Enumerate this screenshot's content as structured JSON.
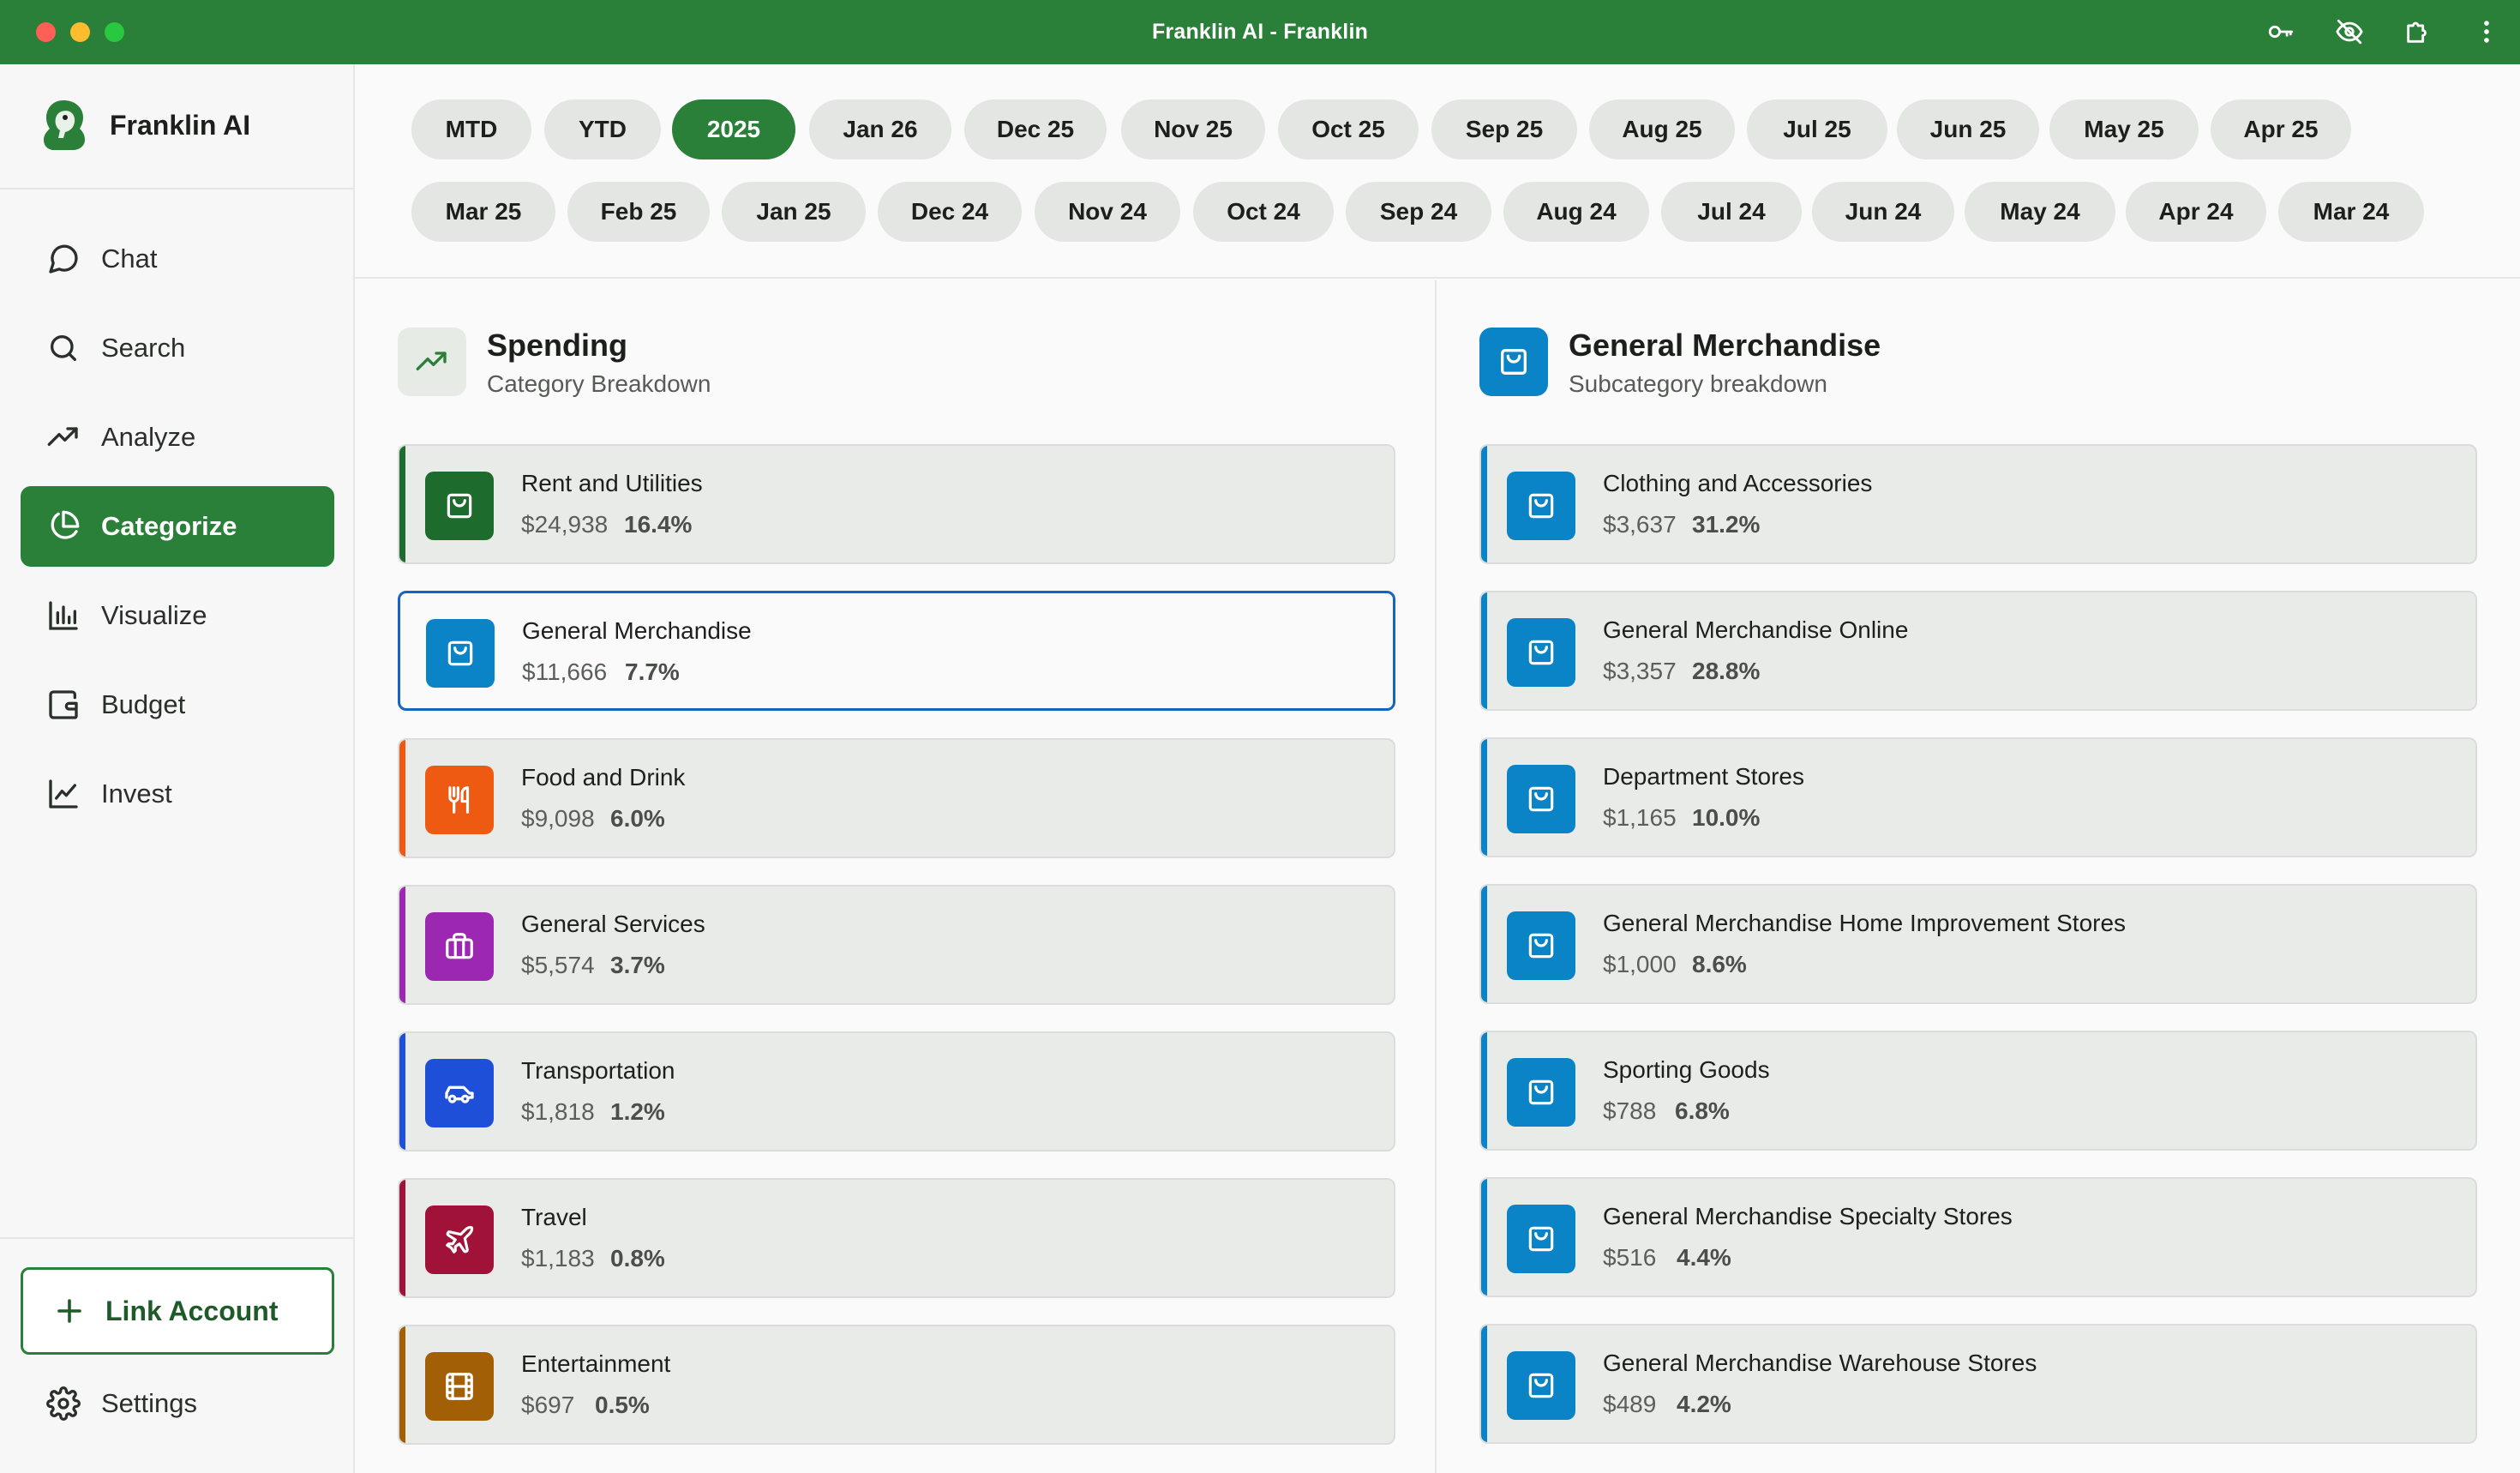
{
  "window": {
    "title": "Franklin AI - Franklin"
  },
  "brand": {
    "name": "Franklin AI"
  },
  "nav": [
    {
      "label": "Chat",
      "icon": "chat-bubble-icon"
    },
    {
      "label": "Search",
      "icon": "search-icon"
    },
    {
      "label": "Analyze",
      "icon": "trending-up-icon"
    },
    {
      "label": "Categorize",
      "icon": "pie-chart-icon",
      "active": true
    },
    {
      "label": "Visualize",
      "icon": "bar-chart-icon"
    },
    {
      "label": "Budget",
      "icon": "wallet-icon"
    },
    {
      "label": "Invest",
      "icon": "line-chart-icon"
    }
  ],
  "sidebar_footer": {
    "link_account": "Link Account",
    "settings": "Settings"
  },
  "periods_row1": [
    "MTD",
    "YTD",
    "2025",
    "Jan 26",
    "Dec 25",
    "Nov 25",
    "Oct 25",
    "Sep 25",
    "Aug 25",
    "Jul 25",
    "Jun 25",
    "May 25",
    "Apr 25"
  ],
  "periods_row2": [
    "Mar 25",
    "Feb 25",
    "Jan 25",
    "Dec 24",
    "Nov 24",
    "Oct 24",
    "Sep 24",
    "Aug 24",
    "Jul 24",
    "Jun 24",
    "May 24",
    "Apr 24",
    "Mar 24"
  ],
  "selected_period": "2025",
  "spending": {
    "title": "Spending",
    "subtitle": "Category Breakdown",
    "categories": [
      {
        "name": "Rent and Utilities",
        "amount": "$24,938",
        "pct": "16.4%",
        "color": "#1e6b2e",
        "icon": "shopping-bag-icon"
      },
      {
        "name": "General Merchandise",
        "amount": "$11,666",
        "pct": "7.7%",
        "color": "#0a84c6",
        "icon": "shopping-bag-icon",
        "selected": true
      },
      {
        "name": "Food and Drink",
        "amount": "$9,098",
        "pct": "6.0%",
        "color": "#ef5a12",
        "icon": "utensils-icon"
      },
      {
        "name": "General Services",
        "amount": "$5,574",
        "pct": "3.7%",
        "color": "#9c27b0",
        "icon": "briefcase-icon"
      },
      {
        "name": "Transportation",
        "amount": "$1,818",
        "pct": "1.2%",
        "color": "#1e4fd8",
        "icon": "car-icon"
      },
      {
        "name": "Travel",
        "amount": "$1,183",
        "pct": "0.8%",
        "color": "#a01237",
        "icon": "plane-icon"
      },
      {
        "name": "Entertainment",
        "amount": "$697",
        "pct": "0.5%",
        "color": "#a35f06",
        "icon": "film-icon"
      }
    ]
  },
  "merch": {
    "title": "General Merchandise",
    "subtitle": "Subcategory breakdown",
    "color": "#0a84c6",
    "subcategories": [
      {
        "name": "Clothing and Accessories",
        "amount": "$3,637",
        "pct": "31.2%"
      },
      {
        "name": "General Merchandise Online",
        "amount": "$3,357",
        "pct": "28.8%"
      },
      {
        "name": "Department Stores",
        "amount": "$1,165",
        "pct": "10.0%"
      },
      {
        "name": "General Merchandise Home Improvement Stores",
        "amount": "$1,000",
        "pct": "8.6%"
      },
      {
        "name": "Sporting Goods",
        "amount": "$788",
        "pct": "6.8%"
      },
      {
        "name": "General Merchandise Specialty Stores",
        "amount": "$516",
        "pct": "4.4%"
      },
      {
        "name": "General Merchandise Warehouse Stores",
        "amount": "$489",
        "pct": "4.2%"
      }
    ]
  },
  "colors": {
    "accent": "#2a7f39",
    "selection": "#1565c0"
  }
}
